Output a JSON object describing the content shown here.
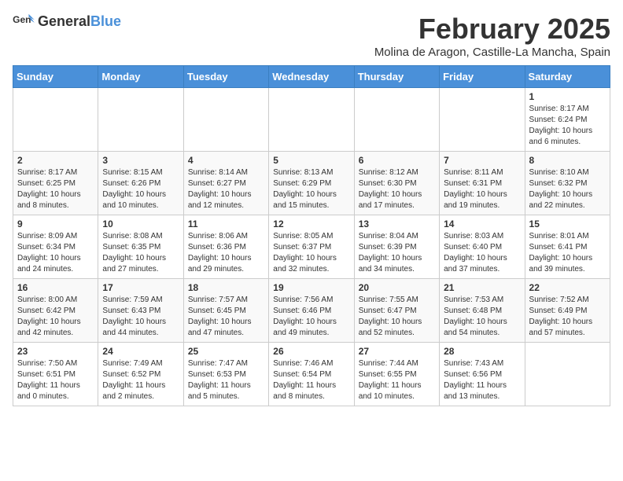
{
  "logo": {
    "text_general": "General",
    "text_blue": "Blue"
  },
  "title": {
    "month": "February 2025",
    "location": "Molina de Aragon, Castille-La Mancha, Spain"
  },
  "weekdays": [
    "Sunday",
    "Monday",
    "Tuesday",
    "Wednesday",
    "Thursday",
    "Friday",
    "Saturday"
  ],
  "weeks": [
    [
      {
        "day": "",
        "info": ""
      },
      {
        "day": "",
        "info": ""
      },
      {
        "day": "",
        "info": ""
      },
      {
        "day": "",
        "info": ""
      },
      {
        "day": "",
        "info": ""
      },
      {
        "day": "",
        "info": ""
      },
      {
        "day": "1",
        "info": "Sunrise: 8:17 AM\nSunset: 6:24 PM\nDaylight: 10 hours and 6 minutes."
      }
    ],
    [
      {
        "day": "2",
        "info": "Sunrise: 8:17 AM\nSunset: 6:25 PM\nDaylight: 10 hours and 8 minutes."
      },
      {
        "day": "3",
        "info": "Sunrise: 8:15 AM\nSunset: 6:26 PM\nDaylight: 10 hours and 10 minutes."
      },
      {
        "day": "4",
        "info": "Sunrise: 8:14 AM\nSunset: 6:27 PM\nDaylight: 10 hours and 12 minutes."
      },
      {
        "day": "5",
        "info": "Sunrise: 8:13 AM\nSunset: 6:29 PM\nDaylight: 10 hours and 15 minutes."
      },
      {
        "day": "6",
        "info": "Sunrise: 8:12 AM\nSunset: 6:30 PM\nDaylight: 10 hours and 17 minutes."
      },
      {
        "day": "7",
        "info": "Sunrise: 8:11 AM\nSunset: 6:31 PM\nDaylight: 10 hours and 19 minutes."
      },
      {
        "day": "8",
        "info": "Sunrise: 8:10 AM\nSunset: 6:32 PM\nDaylight: 10 hours and 22 minutes."
      }
    ],
    [
      {
        "day": "9",
        "info": "Sunrise: 8:09 AM\nSunset: 6:34 PM\nDaylight: 10 hours and 24 minutes."
      },
      {
        "day": "10",
        "info": "Sunrise: 8:08 AM\nSunset: 6:35 PM\nDaylight: 10 hours and 27 minutes."
      },
      {
        "day": "11",
        "info": "Sunrise: 8:06 AM\nSunset: 6:36 PM\nDaylight: 10 hours and 29 minutes."
      },
      {
        "day": "12",
        "info": "Sunrise: 8:05 AM\nSunset: 6:37 PM\nDaylight: 10 hours and 32 minutes."
      },
      {
        "day": "13",
        "info": "Sunrise: 8:04 AM\nSunset: 6:39 PM\nDaylight: 10 hours and 34 minutes."
      },
      {
        "day": "14",
        "info": "Sunrise: 8:03 AM\nSunset: 6:40 PM\nDaylight: 10 hours and 37 minutes."
      },
      {
        "day": "15",
        "info": "Sunrise: 8:01 AM\nSunset: 6:41 PM\nDaylight: 10 hours and 39 minutes."
      }
    ],
    [
      {
        "day": "16",
        "info": "Sunrise: 8:00 AM\nSunset: 6:42 PM\nDaylight: 10 hours and 42 minutes."
      },
      {
        "day": "17",
        "info": "Sunrise: 7:59 AM\nSunset: 6:43 PM\nDaylight: 10 hours and 44 minutes."
      },
      {
        "day": "18",
        "info": "Sunrise: 7:57 AM\nSunset: 6:45 PM\nDaylight: 10 hours and 47 minutes."
      },
      {
        "day": "19",
        "info": "Sunrise: 7:56 AM\nSunset: 6:46 PM\nDaylight: 10 hours and 49 minutes."
      },
      {
        "day": "20",
        "info": "Sunrise: 7:55 AM\nSunset: 6:47 PM\nDaylight: 10 hours and 52 minutes."
      },
      {
        "day": "21",
        "info": "Sunrise: 7:53 AM\nSunset: 6:48 PM\nDaylight: 10 hours and 54 minutes."
      },
      {
        "day": "22",
        "info": "Sunrise: 7:52 AM\nSunset: 6:49 PM\nDaylight: 10 hours and 57 minutes."
      }
    ],
    [
      {
        "day": "23",
        "info": "Sunrise: 7:50 AM\nSunset: 6:51 PM\nDaylight: 11 hours and 0 minutes."
      },
      {
        "day": "24",
        "info": "Sunrise: 7:49 AM\nSunset: 6:52 PM\nDaylight: 11 hours and 2 minutes."
      },
      {
        "day": "25",
        "info": "Sunrise: 7:47 AM\nSunset: 6:53 PM\nDaylight: 11 hours and 5 minutes."
      },
      {
        "day": "26",
        "info": "Sunrise: 7:46 AM\nSunset: 6:54 PM\nDaylight: 11 hours and 8 minutes."
      },
      {
        "day": "27",
        "info": "Sunrise: 7:44 AM\nSunset: 6:55 PM\nDaylight: 11 hours and 10 minutes."
      },
      {
        "day": "28",
        "info": "Sunrise: 7:43 AM\nSunset: 6:56 PM\nDaylight: 11 hours and 13 minutes."
      },
      {
        "day": "",
        "info": ""
      }
    ]
  ]
}
